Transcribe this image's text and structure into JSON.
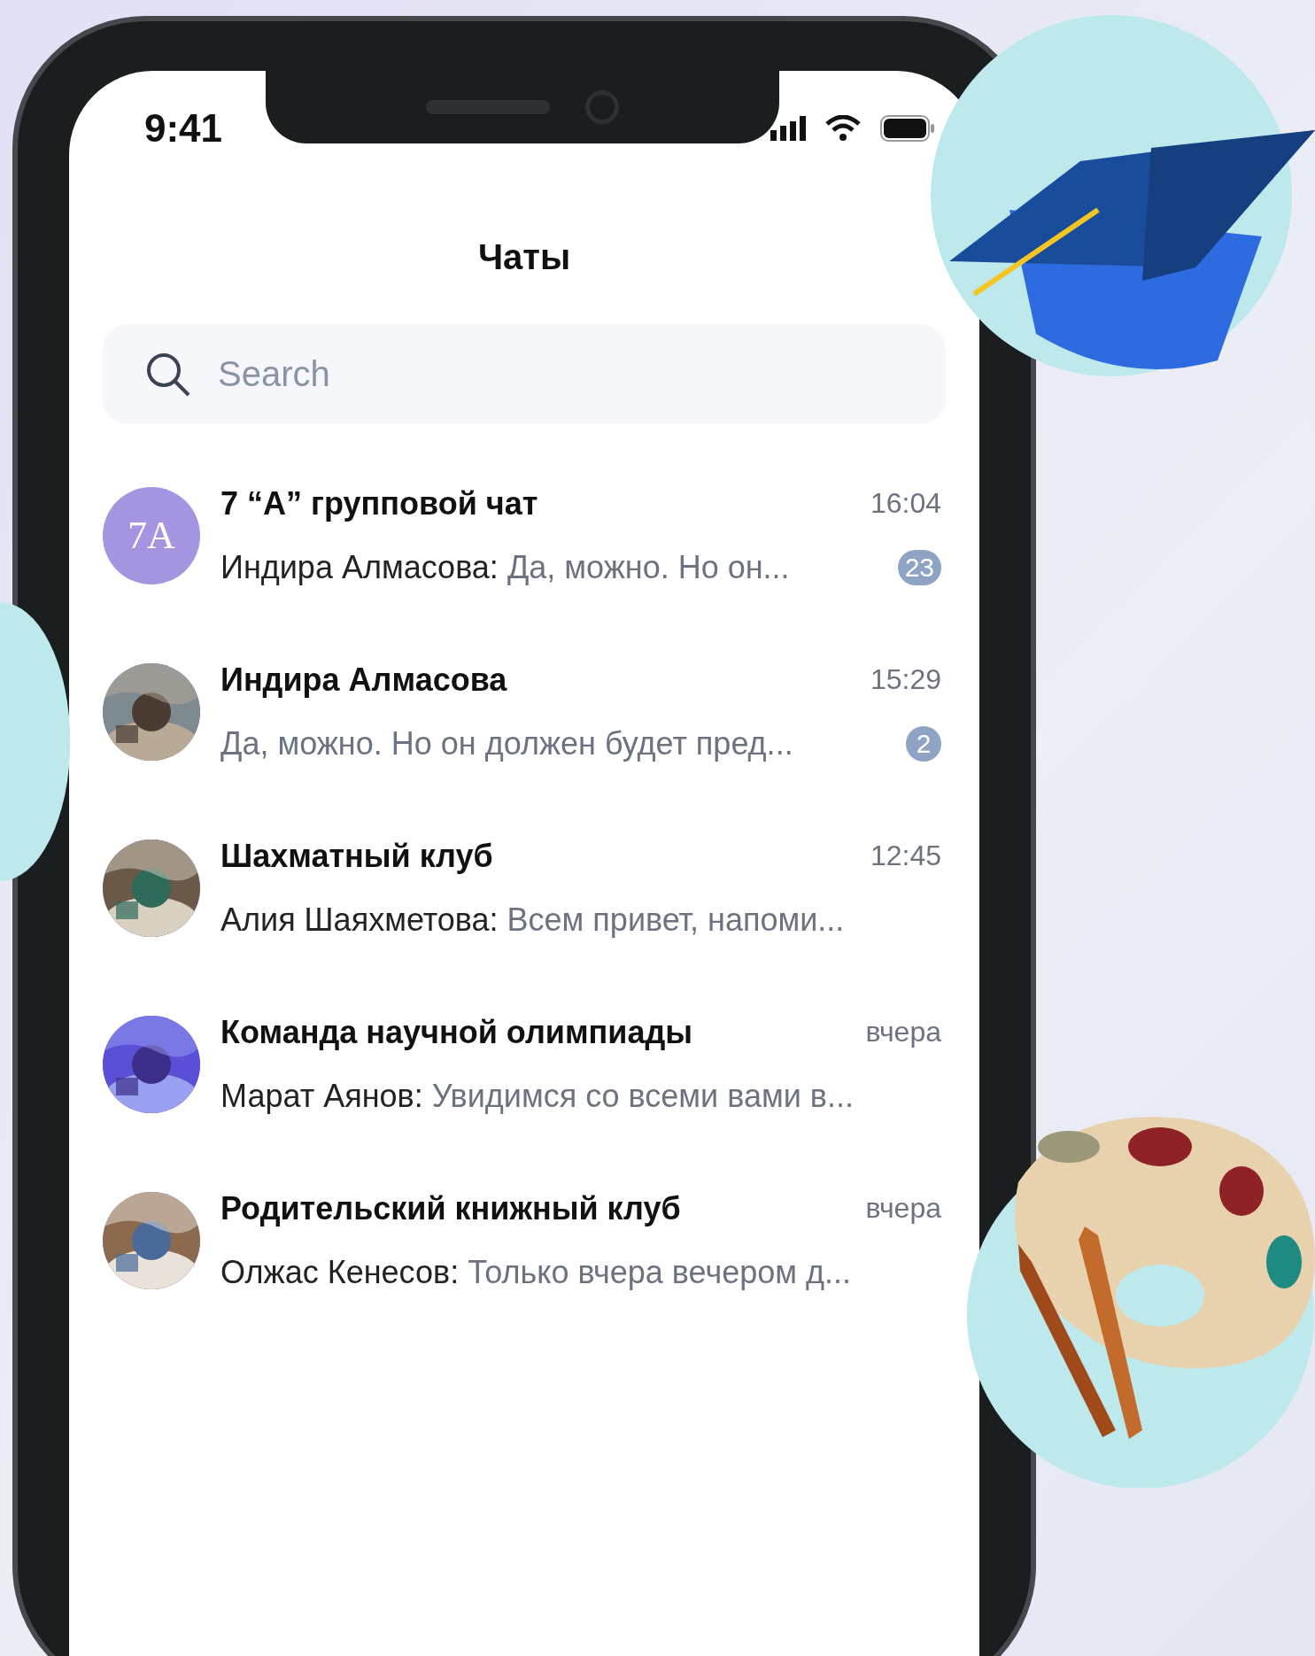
{
  "status_bar": {
    "time": "9:41"
  },
  "header": {
    "title": "Чаты"
  },
  "search": {
    "placeholder": "Search"
  },
  "chats": [
    {
      "name": "7 “A” групповой чат",
      "time": "16:04",
      "sender": "Индира Алмасова:",
      "message": "Да, можно. Но он...",
      "unread": "23",
      "avatar": {
        "kind": "initials",
        "text": "7A"
      }
    },
    {
      "name": "Индира Алмасова",
      "time": "15:29",
      "message": "Да, можно. Но он должен будет пред...",
      "unread": "2"
    },
    {
      "name": "Шахматный клуб",
      "time": "12:45",
      "sender": "Алия Шаяхметова:",
      "message": "Всем привет, напоми..."
    },
    {
      "name": "Команда научной олимпиады",
      "time": "вчера",
      "sender": "Марат Аянов:",
      "message": "Увидимся со всеми вами в..."
    },
    {
      "name": "Родительский книжный клуб",
      "time": "вчера",
      "sender": "Олжас Кенесов:",
      "message": "Только вчера вечером д..."
    }
  ]
}
